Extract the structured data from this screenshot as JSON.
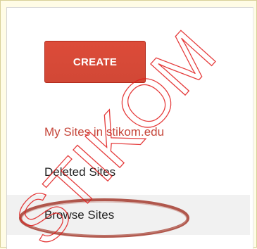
{
  "sidebar": {
    "create_label": "CREATE",
    "items": [
      {
        "label": "My Sites in stikom.edu",
        "selected": false
      },
      {
        "label": "Deleted Sites",
        "selected": false
      },
      {
        "label": "Browse Sites",
        "selected": true
      }
    ]
  },
  "watermark": {
    "text": "STIKOM"
  },
  "colors": {
    "create_button": "#d14836",
    "my_sites_link": "#c5463a",
    "highlight_ellipse": "#a8463a",
    "selected_row": "#f1f1f1"
  }
}
